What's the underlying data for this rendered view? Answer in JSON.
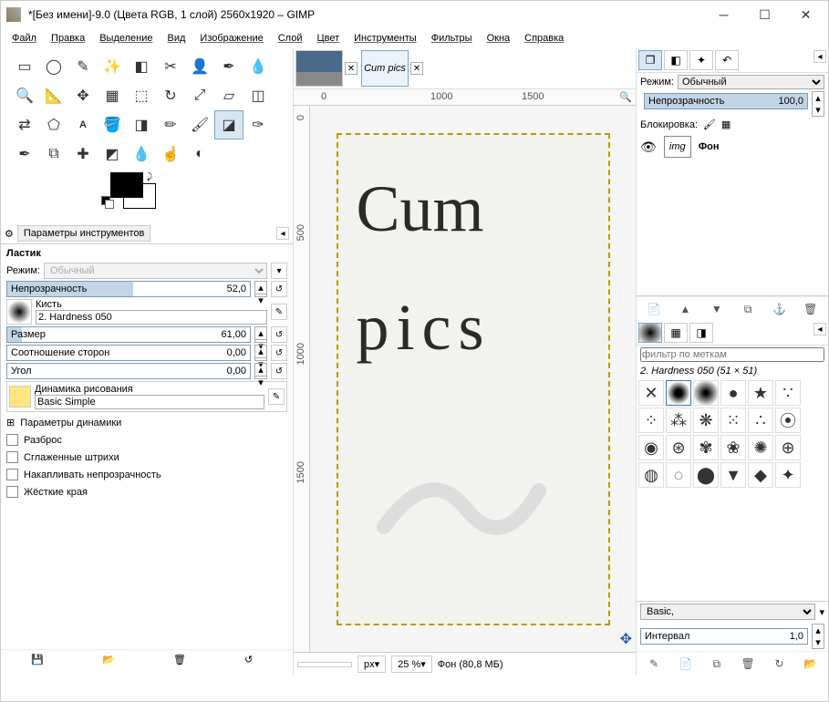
{
  "window": {
    "title": "*[Без имени]-9.0 (Цвета RGB, 1 слой) 2560x1920 – GIMP"
  },
  "menu": [
    "Файл",
    "Правка",
    "Выделение",
    "Вид",
    "Изображение",
    "Слой",
    "Цвет",
    "Инструменты",
    "Фильтры",
    "Окна",
    "Справка"
  ],
  "tool_options_tab": "Параметры инструментов",
  "opts": {
    "tool": "Ластик",
    "mode_label": "Режим:",
    "mode": "Обычный",
    "opacity_label": "Непрозрачность",
    "opacity": "52,0",
    "brush_label": "Кисть",
    "brush": "2. Hardness 050",
    "size_label": "Размер",
    "size": "61,00",
    "aspect_label": "Соотношение сторон",
    "aspect": "0,00",
    "angle_label": "Угол",
    "angle": "0,00",
    "dynamics_label": "Динамика рисования",
    "dynamics": "Basic Simple",
    "dyn_params": "Параметры динамики",
    "chk1": "Разброс",
    "chk2": "Сглаженные штрихи",
    "chk3": "Накапливать непрозрачность",
    "chk4": "Жёсткие края"
  },
  "ruler": {
    "h1": "0",
    "h2": "1000",
    "h3": "1500",
    "v1": "0",
    "v2": "500",
    "v3": "1000",
    "v4": "1500"
  },
  "status": {
    "unit": "px",
    "zoom": "25 %",
    "info": "Фон (80,8 МБ)"
  },
  "layers": {
    "mode_label": "Режим:",
    "mode": "Обычный",
    "opacity_label": "Непрозрачность",
    "opacity": "100,0",
    "lock_label": "Блокировка:",
    "layer1": "Фон"
  },
  "brushes": {
    "filter_placeholder": "фильтр по меткам",
    "current": "2. Hardness 050 (51 × 51)",
    "preset": "Basic,",
    "interval_label": "Интервал",
    "interval": "1,0"
  },
  "canvas_text": {
    "line1": "Cum",
    "line2": "pics"
  }
}
